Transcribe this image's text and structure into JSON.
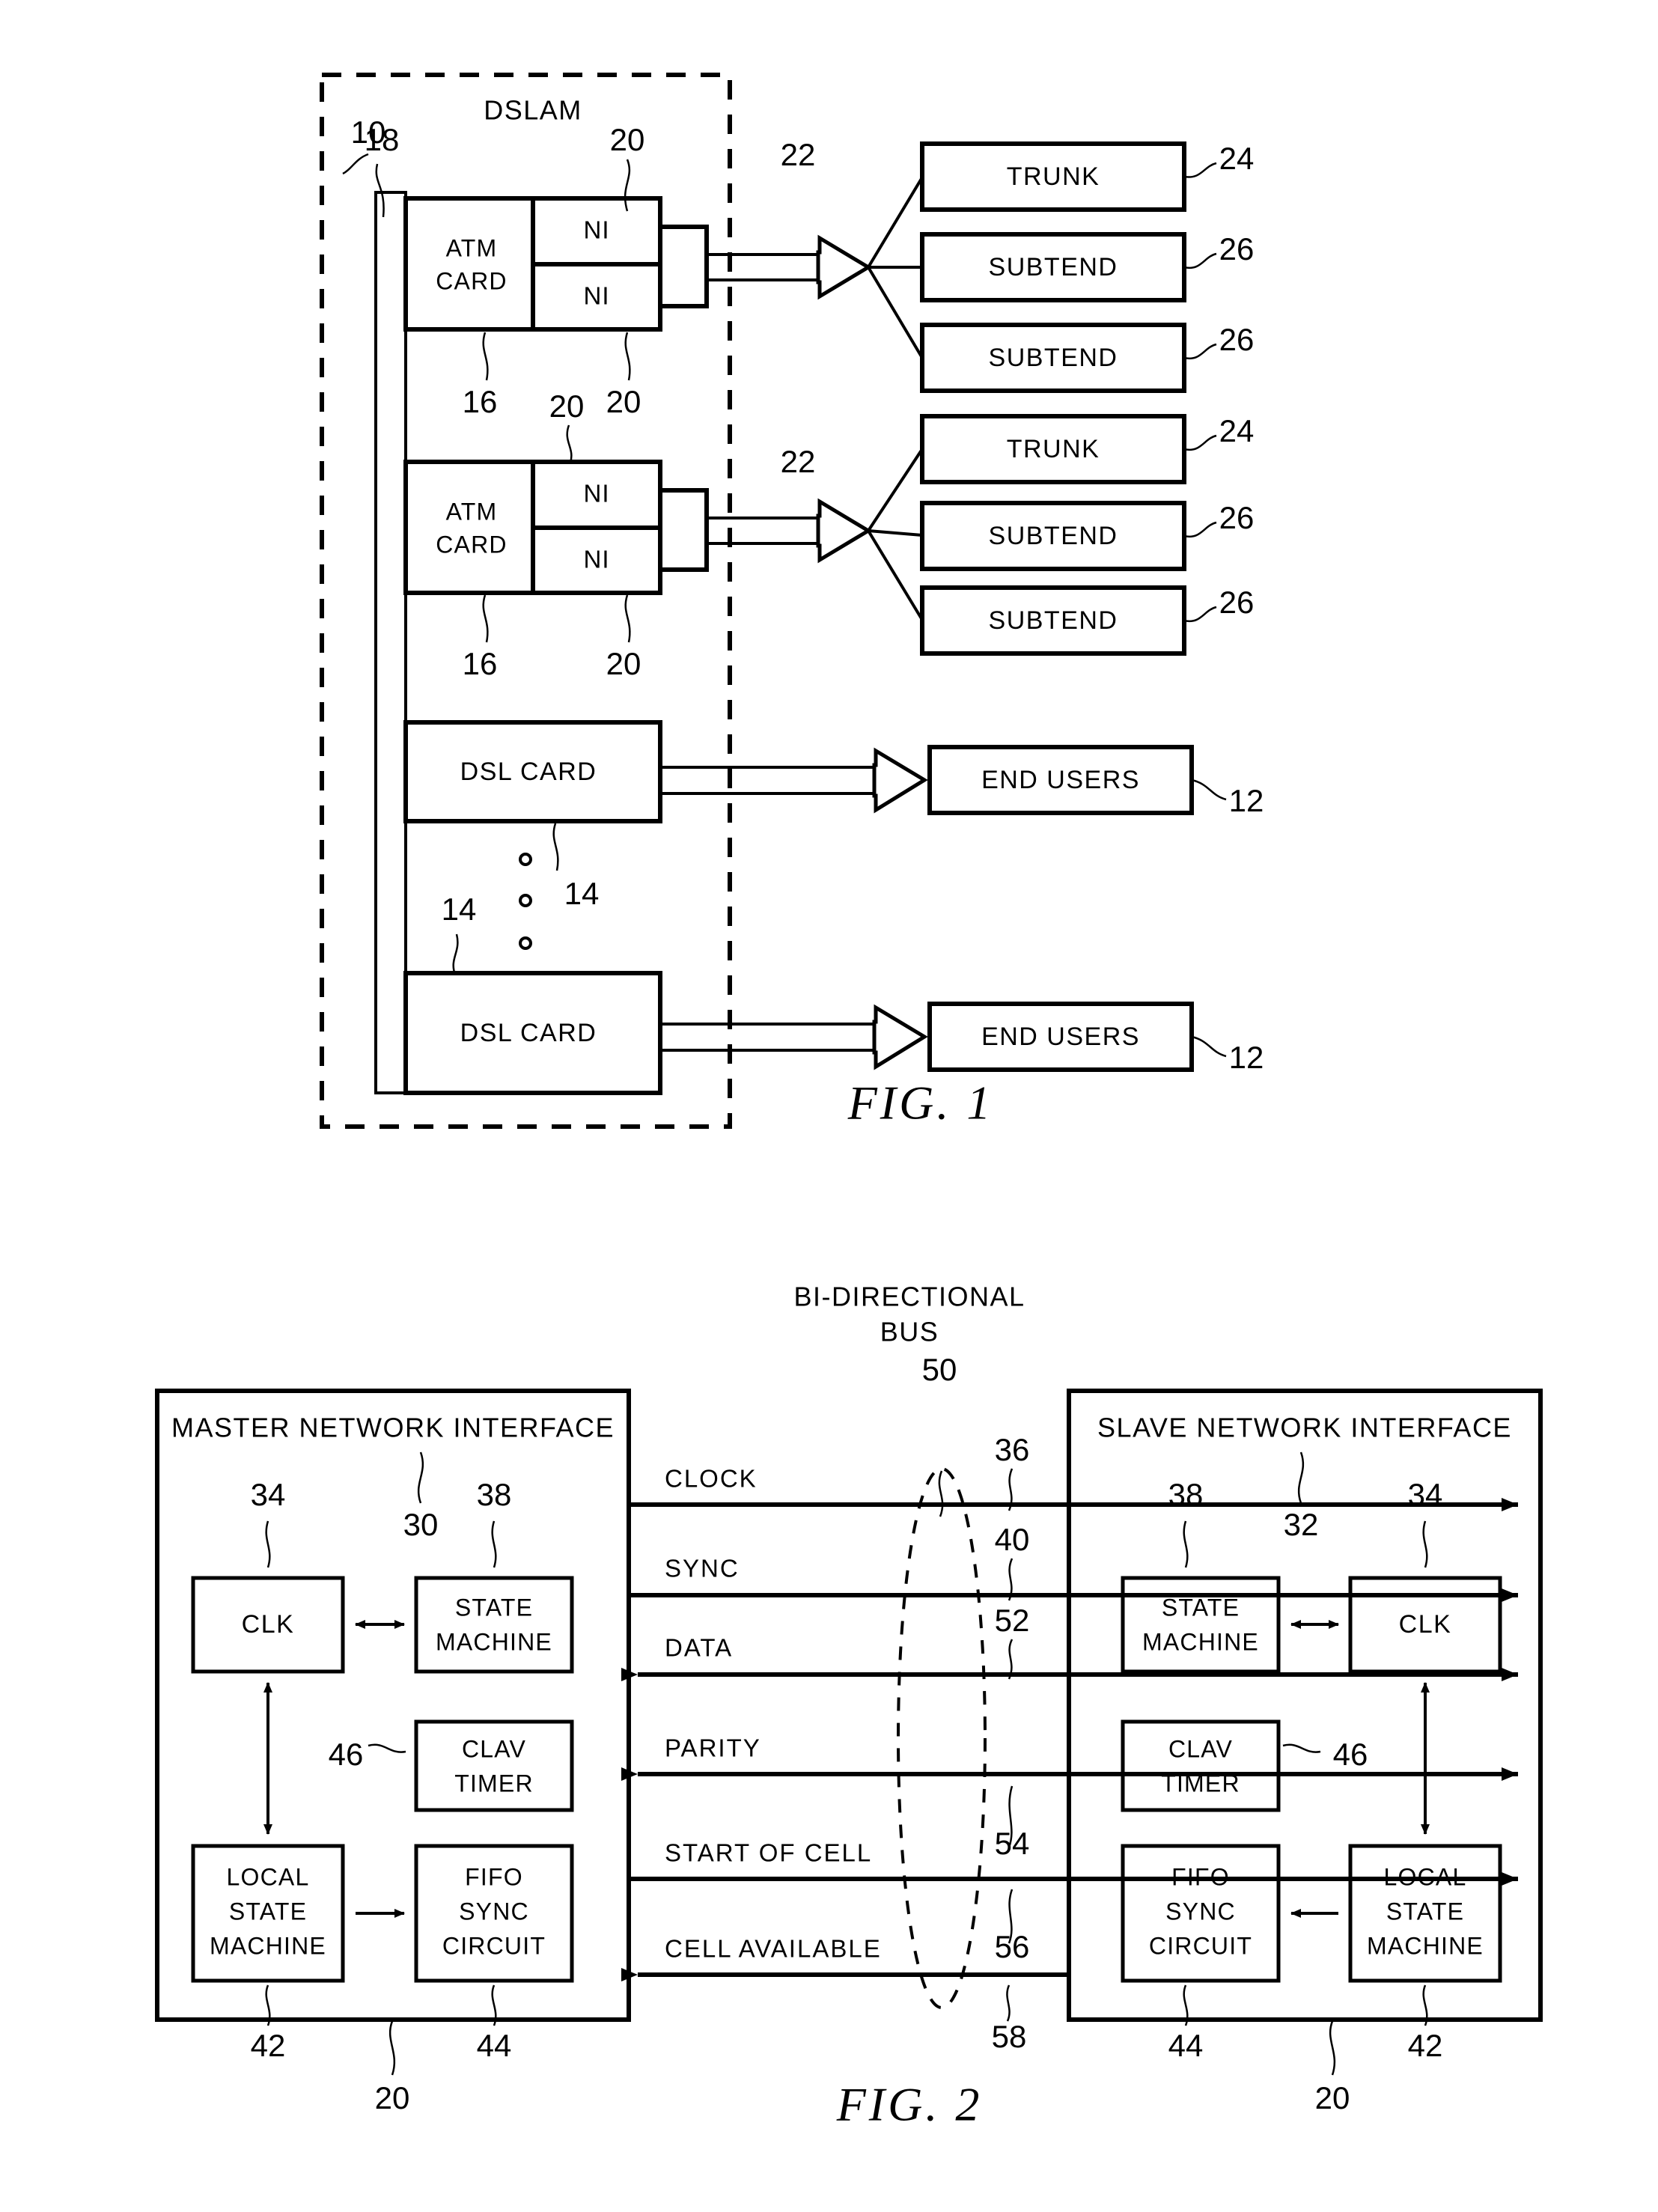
{
  "document": {
    "type": "patent-figure-sheet",
    "figures": [
      "FIG. 1",
      "FIG. 2"
    ]
  },
  "fig1": {
    "caption": "FIG. 1",
    "enclosure_label": "DSLAM",
    "ref_system": "10",
    "ref_backplane": "18",
    "cards": [
      {
        "label": "ATM CARD",
        "ref": "16",
        "ni": [
          {
            "label": "NI",
            "ref": "20"
          },
          {
            "label": "NI",
            "ref": "20"
          }
        ]
      },
      {
        "label": "ATM CARD",
        "ref": "16",
        "ni": [
          {
            "label": "NI",
            "ref": "20"
          },
          {
            "label": "NI",
            "ref": "20"
          }
        ]
      },
      {
        "label": "DSL CARD",
        "ref": "14"
      },
      {
        "label": "DSL CARD",
        "ref": "14"
      }
    ],
    "links": [
      {
        "ref": "22"
      },
      {
        "ref": "22"
      }
    ],
    "destinations_group_1": [
      {
        "label": "TRUNK",
        "ref": "24"
      },
      {
        "label": "SUBTEND",
        "ref": "26"
      },
      {
        "label": "SUBTEND",
        "ref": "26"
      }
    ],
    "destinations_group_2": [
      {
        "label": "TRUNK",
        "ref": "24"
      },
      {
        "label": "SUBTEND",
        "ref": "26"
      },
      {
        "label": "SUBTEND",
        "ref": "26"
      }
    ],
    "end_users": [
      {
        "label": "END USERS",
        "ref": "12"
      },
      {
        "label": "END USERS",
        "ref": "12"
      }
    ],
    "ellipsis": "⋮"
  },
  "fig2": {
    "caption": "FIG. 2",
    "bus_title_line1": "BI-DIRECTIONAL",
    "bus_title_line2": "BUS",
    "bus_ref": "50",
    "master": {
      "title": "MASTER NETWORK INTERFACE",
      "ref": "30",
      "outer_ref": "20",
      "blocks": [
        {
          "label": "CLK",
          "ref": "34"
        },
        {
          "label": "STATE MACHINE",
          "ref": "38"
        },
        {
          "label": "CLAV TIMER",
          "ref": "46"
        },
        {
          "label": "LOCAL STATE MACHINE",
          "ref": "42"
        },
        {
          "label": "FIFO SYNC CIRCUIT",
          "ref": "44"
        }
      ]
    },
    "slave": {
      "title": "SLAVE NETWORK INTERFACE",
      "ref": "32",
      "outer_ref": "20",
      "blocks": [
        {
          "label": "STATE MACHINE",
          "ref": "38"
        },
        {
          "label": "CLK",
          "ref": "34"
        },
        {
          "label": "CLAV TIMER",
          "ref": "46"
        },
        {
          "label": "FIFO SYNC CIRCUIT",
          "ref": "44"
        },
        {
          "label": "LOCAL STATE MACHINE",
          "ref": "42"
        }
      ]
    },
    "signals": [
      {
        "label": "CLOCK",
        "ref": "36",
        "direction": "right"
      },
      {
        "label": "SYNC",
        "ref": "40",
        "direction": "right"
      },
      {
        "label": "DATA",
        "ref": "52",
        "direction": "both"
      },
      {
        "label": "PARITY",
        "ref": "",
        "direction": "both"
      },
      {
        "label": "START OF CELL",
        "ref": "54",
        "direction": "right"
      },
      {
        "label": "CELL AVAILABLE",
        "ref": "56",
        "direction": "left"
      }
    ],
    "extra_ref": "58"
  }
}
